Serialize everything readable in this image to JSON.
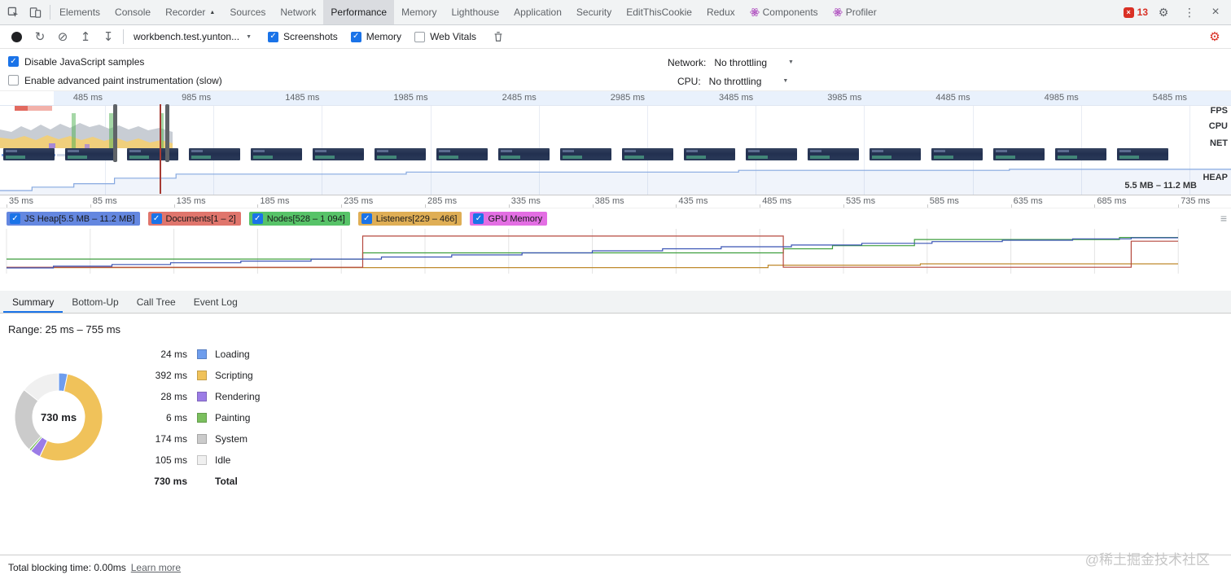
{
  "icons": {
    "reload": "↻",
    "clear": "⊘",
    "load": "↥",
    "save": "↧",
    "gear": "⚙",
    "more": "⋮",
    "close": "×",
    "dropdown": "▼",
    "menu": "≡",
    "check": "✓",
    "error": "×"
  },
  "tabbar": {
    "tabs": [
      {
        "label": "Elements"
      },
      {
        "label": "Console"
      },
      {
        "label": "Recorder",
        "suffix": "▲"
      },
      {
        "label": "Sources"
      },
      {
        "label": "Network"
      },
      {
        "label": "Performance",
        "active": true
      },
      {
        "label": "Memory"
      },
      {
        "label": "Lighthouse"
      },
      {
        "label": "Application"
      },
      {
        "label": "Security"
      },
      {
        "label": "EditThisCookie"
      },
      {
        "label": "Redux"
      },
      {
        "label": "Components",
        "icon": "react"
      },
      {
        "label": "Profiler",
        "icon": "react"
      }
    ],
    "error_count": "13"
  },
  "toolbar": {
    "history_select": "workbench.test.yunton...",
    "checks": [
      {
        "label": "Screenshots",
        "checked": true
      },
      {
        "label": "Memory",
        "checked": true
      },
      {
        "label": "Web Vitals",
        "checked": false
      }
    ]
  },
  "options": {
    "rows": [
      {
        "label": "Disable JavaScript samples",
        "checked": true
      },
      {
        "label": "Enable advanced paint instrumentation (slow)",
        "checked": false
      }
    ],
    "network_label": "Network:",
    "network_value": "No throttling",
    "cpu_label": "CPU:",
    "cpu_value": "No throttling"
  },
  "overview": {
    "ruler": [
      "485 ms",
      "985 ms",
      "1485 ms",
      "1985 ms",
      "2485 ms",
      "2985 ms",
      "3485 ms",
      "3985 ms",
      "4485 ms",
      "4985 ms",
      "5485 ms"
    ],
    "fps_label": "FPS",
    "cpu_label": "CPU",
    "net_label": "NET",
    "heap_label": "HEAP",
    "heap_range": "5.5 MB – 11.2 MB",
    "filmstrip_count": 19
  },
  "counters": {
    "ruler": [
      "35 ms",
      "85 ms",
      "135 ms",
      "185 ms",
      "235 ms",
      "285 ms",
      "335 ms",
      "385 ms",
      "435 ms",
      "485 ms",
      "535 ms",
      "585 ms",
      "635 ms",
      "685 ms",
      "735 ms"
    ],
    "items": [
      {
        "label": "JS Heap[5.5 MB – 11.2 MB]",
        "checked": true,
        "chip": "#6487e0"
      },
      {
        "label": "Documents[1 – 2]",
        "checked": true,
        "chip": "#e0756c"
      },
      {
        "label": "Nodes[528 – 1 094]",
        "checked": true,
        "chip": "#57c368"
      },
      {
        "label": "Listeners[229 – 466]",
        "checked": true,
        "chip": "#dfae55"
      },
      {
        "label": "GPU Memory",
        "checked": true,
        "chip": "#e36ee3"
      }
    ]
  },
  "chart_data": [
    {
      "type": "line",
      "title": "Memory counters",
      "x_range_ms": [
        25,
        755
      ],
      "series": [
        {
          "name": "JS Heap",
          "visible_range": "5.5 MB – 11.2 MB",
          "color": "#3b55b5",
          "points_pct": [
            [
              0,
              100
            ],
            [
              4,
              100
            ],
            [
              4,
              95
            ],
            [
              9,
              95
            ],
            [
              9,
              90
            ],
            [
              14,
              90
            ],
            [
              14,
              85
            ],
            [
              20,
              85
            ],
            [
              20,
              80
            ],
            [
              26,
              80
            ],
            [
              26,
              74
            ],
            [
              32,
              74
            ],
            [
              32,
              68
            ],
            [
              38,
              68
            ],
            [
              38,
              62
            ],
            [
              44,
              62
            ],
            [
              44,
              56
            ],
            [
              50,
              56
            ],
            [
              50,
              50
            ],
            [
              56,
              50
            ],
            [
              56,
              44
            ],
            [
              61,
              44
            ],
            [
              61,
              38
            ],
            [
              67,
              38
            ],
            [
              67,
              33
            ],
            [
              73,
              33
            ],
            [
              73,
              28
            ],
            [
              79,
              28
            ],
            [
              79,
              23
            ],
            [
              85,
              23
            ],
            [
              85,
              19
            ],
            [
              91,
              19
            ],
            [
              91,
              15
            ],
            [
              96,
              15
            ],
            [
              96,
              12
            ],
            [
              100,
              12
            ]
          ]
        },
        {
          "name": "Documents",
          "visible_range": "1 – 2",
          "color": "#b5493e",
          "points_pct": [
            [
              0,
              98
            ],
            [
              30.4,
              98
            ],
            [
              30.4,
              7
            ],
            [
              66.3,
              7
            ],
            [
              66.3,
              98
            ],
            [
              96,
              98
            ],
            [
              96,
              22
            ],
            [
              100,
              22
            ]
          ]
        },
        {
          "name": "Nodes",
          "visible_range": "528 – 1 094",
          "color": "#3f9e3f",
          "points_pct": [
            [
              0,
              74
            ],
            [
              30.4,
              74
            ],
            [
              30.4,
              56
            ],
            [
              66.3,
              56
            ],
            [
              66.3,
              44
            ],
            [
              70.5,
              44
            ],
            [
              70.5,
              35
            ],
            [
              77.5,
              35
            ],
            [
              77.5,
              17
            ],
            [
              95,
              17
            ],
            [
              95,
              11
            ],
            [
              100,
              11
            ]
          ]
        },
        {
          "name": "Listeners",
          "visible_range": "229 – 466",
          "color": "#bf8a2e",
          "points_pct": [
            [
              0,
              99
            ],
            [
              65,
              99
            ],
            [
              65,
              92
            ],
            [
              78,
              92
            ],
            [
              78,
              88
            ],
            [
              100,
              88
            ]
          ]
        }
      ]
    },
    {
      "type": "pie",
      "title": "Summary",
      "categories": [
        "Loading",
        "Scripting",
        "Rendering",
        "Painting",
        "System",
        "Idle"
      ],
      "values_ms": [
        24,
        392,
        28,
        6,
        174,
        105
      ],
      "total_ms": 730,
      "colors": [
        "#6e9ded",
        "#f0c25a",
        "#9b7ce6",
        "#7bbf5e",
        "#cbcbcb",
        "#f0f0f0"
      ]
    },
    {
      "type": "area",
      "title": "Overview JS Heap",
      "y_range": "5.5 MB – 11.2 MB",
      "shape_points_pct": [
        [
          0,
          88
        ],
        [
          2.6,
          88
        ],
        [
          2.6,
          78
        ],
        [
          6,
          78
        ],
        [
          6,
          68
        ],
        [
          9.3,
          68
        ],
        [
          9.3,
          52
        ],
        [
          14.3,
          52
        ],
        [
          14.3,
          40
        ],
        [
          33,
          40
        ],
        [
          33,
          34
        ],
        [
          60,
          34
        ],
        [
          60,
          29
        ],
        [
          82,
          29
        ],
        [
          82,
          26
        ],
        [
          100,
          26
        ]
      ]
    }
  ],
  "details": {
    "tabs": [
      "Summary",
      "Bottom-Up",
      "Call Tree",
      "Event Log"
    ],
    "active_tab": "Summary",
    "range_text": "Range: 25 ms – 755 ms",
    "donut_center": "730 ms",
    "legend": [
      {
        "value": "24 ms",
        "label": "Loading"
      },
      {
        "value": "392 ms",
        "label": "Scripting"
      },
      {
        "value": "28 ms",
        "label": "Rendering"
      },
      {
        "value": "6 ms",
        "label": "Painting"
      },
      {
        "value": "174 ms",
        "label": "System"
      },
      {
        "value": "105 ms",
        "label": "Idle"
      }
    ],
    "total": {
      "value": "730 ms",
      "label": "Total"
    }
  },
  "statusbar": {
    "text": "Total blocking time: 0.00ms",
    "link": "Learn more",
    "watermark": "@稀土掘金技术社区"
  }
}
